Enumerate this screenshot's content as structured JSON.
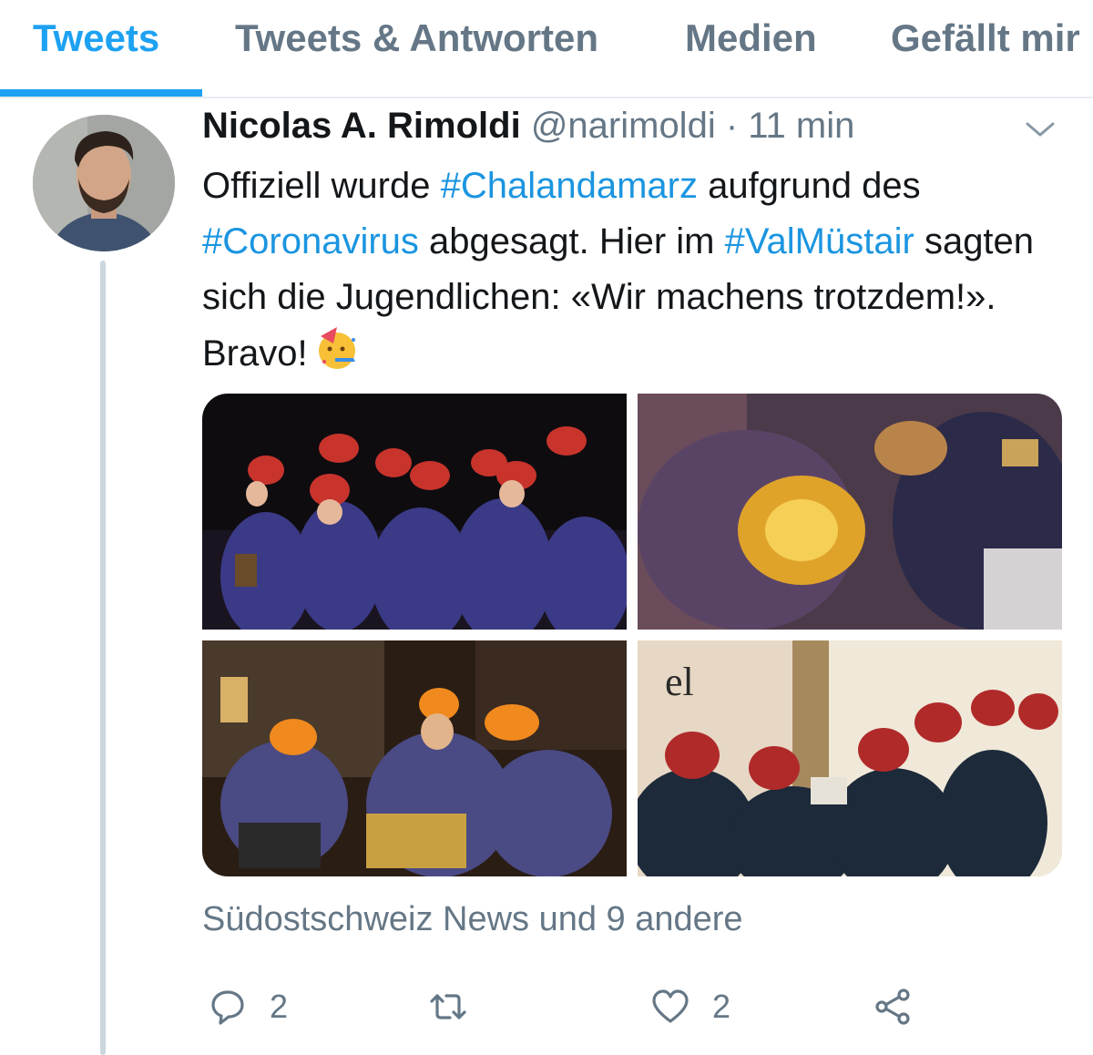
{
  "tabs": [
    {
      "label": "Tweets",
      "active": true
    },
    {
      "label": "Tweets & Antworten",
      "active": false
    },
    {
      "label": "Medien",
      "active": false
    },
    {
      "label": "Gefällt mir",
      "active": false
    }
  ],
  "tweet": {
    "author_name": "Nicolas A. Rimoldi",
    "handle": "@narimoldi",
    "separator": "·",
    "time": "11 min",
    "text_parts": {
      "p1": "Offiziell wurde ",
      "tag1": "#Chalandamarz",
      "p2": " aufgrund des ",
      "tag2": "#Coronavirus",
      "p3": " abgesagt. Hier im ",
      "tag3": "#ValMüstair",
      "p4": " sagten sich die Jugendlichen: «Wir machens trotzdem!». Bravo!"
    },
    "emoji": "partying-face-emoji",
    "photo_sign_text": "el",
    "social_context": "Südostschweiz News und 9 andere",
    "actions": {
      "reply_count": "2",
      "retweet_count": "",
      "like_count": "2"
    }
  },
  "colors": {
    "accent": "#1da1f2",
    "link": "#1b95e0",
    "secondary_text": "#657786",
    "divider": "#e6ecf0"
  },
  "icons": [
    "chevron-down-icon",
    "reply-icon",
    "retweet-icon",
    "like-icon",
    "share-icon"
  ]
}
